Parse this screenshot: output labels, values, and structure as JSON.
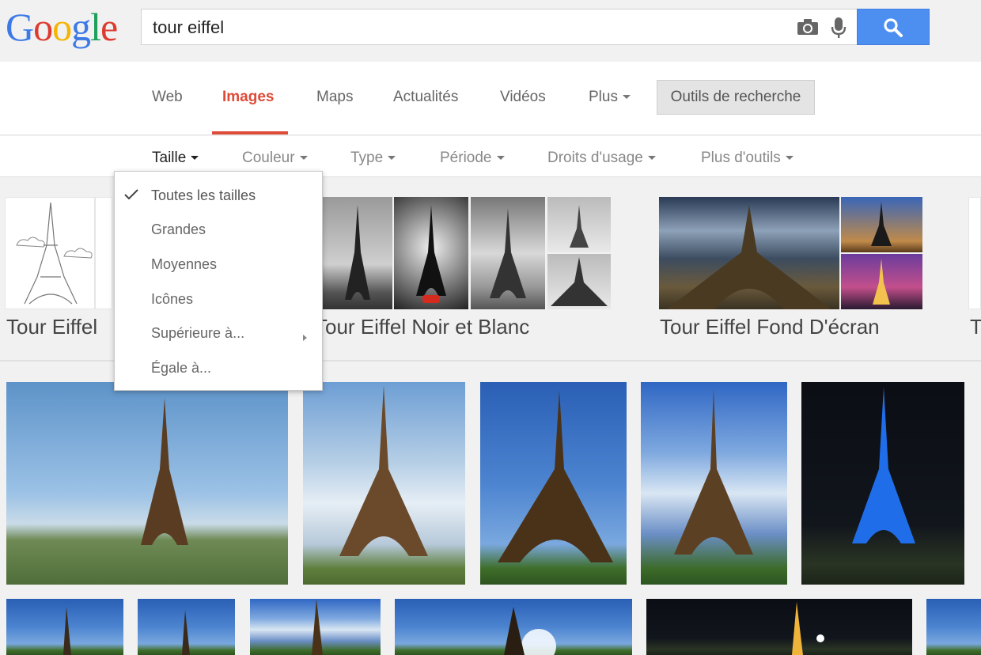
{
  "logo": {
    "letters": [
      "G",
      "o",
      "o",
      "g",
      "l",
      "e"
    ],
    "colors": [
      "#3c79e6",
      "#dd3b2f",
      "#f4b400",
      "#3c79e6",
      "#1ea05b",
      "#dd3b2f"
    ]
  },
  "search": {
    "query": "tour eiffel"
  },
  "icons": {
    "camera": "camera-icon",
    "microphone": "microphone-icon",
    "search": "search-icon"
  },
  "nav": {
    "tabs": [
      {
        "label": "Web",
        "active": false
      },
      {
        "label": "Images",
        "active": true
      },
      {
        "label": "Maps",
        "active": false
      },
      {
        "label": "Actualités",
        "active": false
      },
      {
        "label": "Vidéos",
        "active": false
      },
      {
        "label": "Plus",
        "active": false
      }
    ],
    "tools_button": "Outils de recherche",
    "active_color": "#dd4b39"
  },
  "tools": [
    {
      "label": "Taille",
      "active": true
    },
    {
      "label": "Couleur",
      "active": false
    },
    {
      "label": "Type",
      "active": false
    },
    {
      "label": "Période",
      "active": false
    },
    {
      "label": "Droits d'usage",
      "active": false
    },
    {
      "label": "Plus d'outils",
      "active": false
    }
  ],
  "size_menu": {
    "items": [
      "Toutes les tailles",
      "Grandes",
      "Moyennes",
      "Icônes",
      "Supérieure à...",
      "Égale à..."
    ],
    "selected": "Toutes les tailles"
  },
  "related": [
    {
      "label": "Tour Eiffel"
    },
    {
      "label": "Tour Eiffel Noir et Blanc"
    },
    {
      "label": "Tour Eiffel Fond D'écran"
    },
    {
      "label": "T"
    }
  ]
}
